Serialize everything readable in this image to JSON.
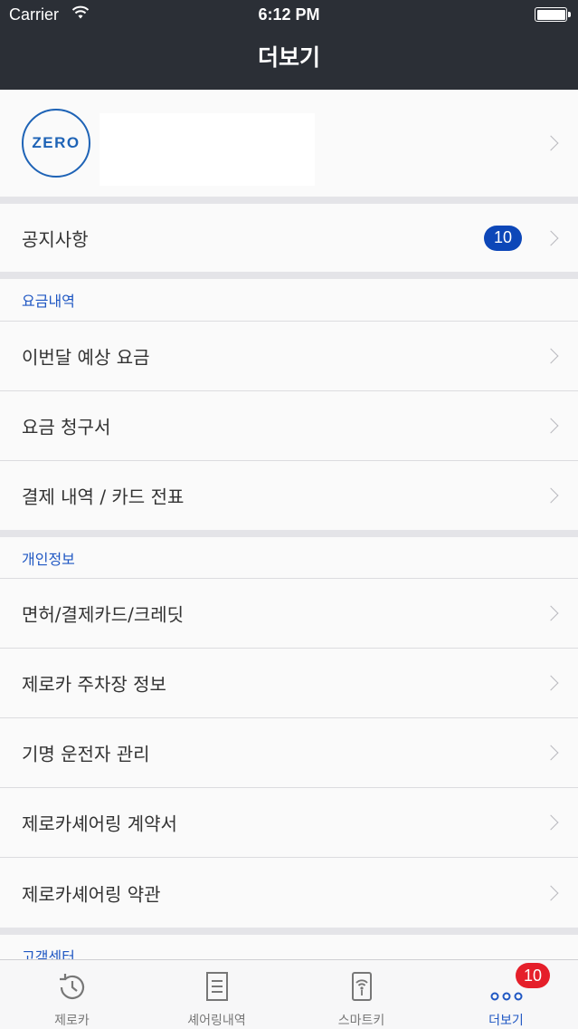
{
  "status_bar": {
    "carrier": "Carrier",
    "time": "6:12 PM"
  },
  "nav": {
    "title": "더보기"
  },
  "profile": {
    "logo_text": "ZERO"
  },
  "notice": {
    "label": "공지사항",
    "badge": "10"
  },
  "billing": {
    "section_title": "요금내역",
    "items": [
      "이번달 예상 요금",
      "요금 청구서",
      "결제 내역 / 카드 전표"
    ]
  },
  "personal": {
    "section_title": "개인정보",
    "items": [
      "면허/결제카드/크레딧",
      "제로카 주차장 정보",
      "기명 운전자 관리",
      "제로카셰어링 계약서",
      "제로카셰어링 약관"
    ]
  },
  "support": {
    "section_title": "고객센터"
  },
  "tabbar": {
    "tabs": [
      {
        "label": "제로카",
        "icon": "history-clock-icon"
      },
      {
        "label": "셰어링내역",
        "icon": "document-list-icon"
      },
      {
        "label": "스마트키",
        "icon": "smart-key-icon"
      },
      {
        "label": "더보기",
        "icon": "more-dots-icon"
      }
    ],
    "more_badge": "10"
  },
  "colors": {
    "nav_bg": "#2b2f36",
    "accent": "#1f57c3",
    "notice_badge": "#0d47b8",
    "tab_badge": "#e51f2a"
  }
}
